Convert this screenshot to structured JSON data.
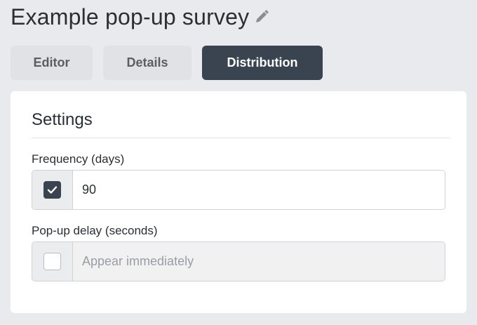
{
  "header": {
    "title": "Example pop-up survey",
    "edit_icon": "pencil-icon"
  },
  "tabs": [
    {
      "label": "Editor",
      "active": false
    },
    {
      "label": "Details",
      "active": false
    },
    {
      "label": "Distribution",
      "active": true
    }
  ],
  "settings": {
    "title": "Settings",
    "frequency": {
      "label": "Frequency (days)",
      "checked": true,
      "value": "90",
      "placeholder": ""
    },
    "delay": {
      "label": "Pop-up delay (seconds)",
      "checked": false,
      "value": "",
      "placeholder": "Appear immediately"
    }
  },
  "colors": {
    "active_tab": "#3a4450",
    "background": "#e9eaee"
  }
}
